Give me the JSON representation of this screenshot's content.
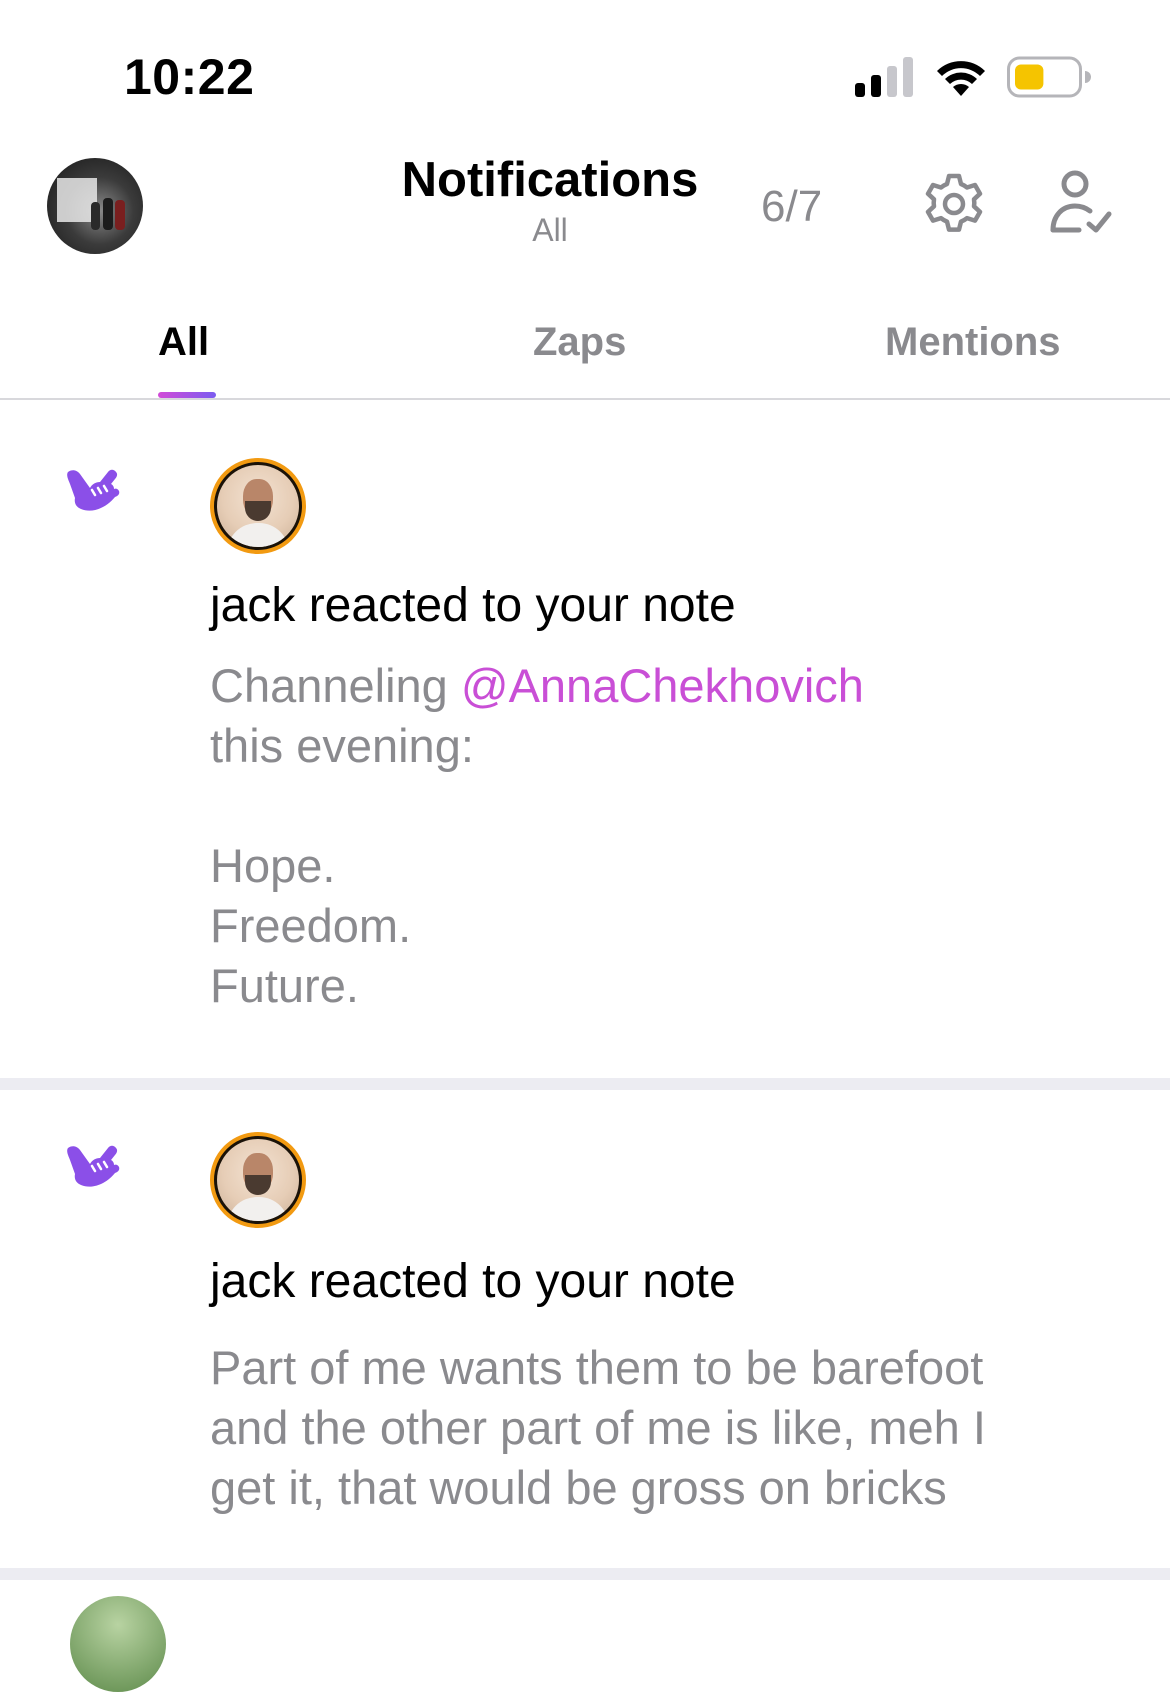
{
  "status_bar": {
    "time": "10:22",
    "signal_icon": "cellular-signal-icon",
    "wifi_icon": "wifi-icon",
    "battery_icon": "battery-icon",
    "battery_level": 0.45,
    "battery_color": "#f5c400"
  },
  "header": {
    "title": "Notifications",
    "subtitle": "All",
    "counter": "6/7",
    "settings_icon": "gear-icon",
    "follow_icon": "user-check-icon"
  },
  "tabs": [
    {
      "label": "All",
      "active": true
    },
    {
      "label": "Zaps",
      "active": false
    },
    {
      "label": "Mentions",
      "active": false
    }
  ],
  "colors": {
    "accent_gradient_start": "#d24bd8",
    "accent_gradient_end": "#7b5cf0",
    "mention": "#c94fd6",
    "muted_text": "#8a8a8e",
    "reaction_icon": "#8b4fe8",
    "avatar_ring": "#f29a11"
  },
  "notifications": [
    {
      "icon": "shaka-hand-icon",
      "title": "jack reacted to your note",
      "body": {
        "line1_prefix": "Channeling ",
        "mention": "@AnnaChekhovich",
        "line2": "this evening:",
        "line3": "Hope.",
        "line4": "Freedom.",
        "line5": "Future."
      }
    },
    {
      "icon": "shaka-hand-icon",
      "title": "jack reacted to your note",
      "body": {
        "line1": "Part of me wants them to be barefoot",
        "line2": "and the other part of me is like, meh I",
        "line3": "get it, that would be gross on bricks"
      }
    }
  ]
}
